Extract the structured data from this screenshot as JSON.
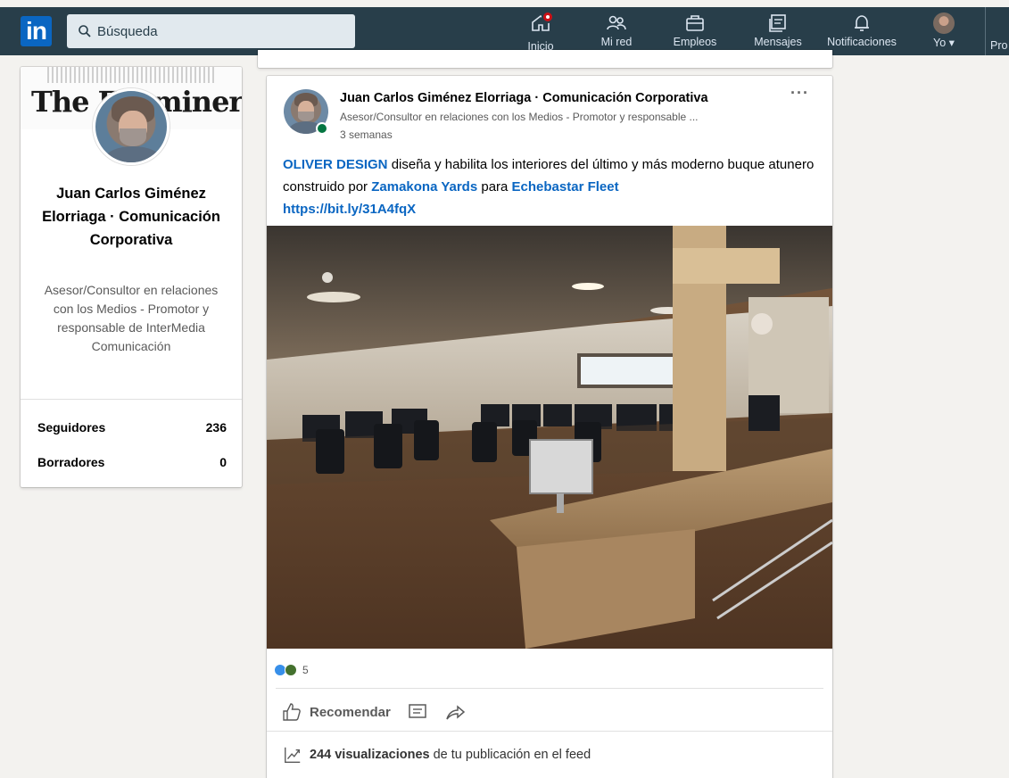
{
  "nav": {
    "logo": "in",
    "search_placeholder": "Búsqueda",
    "items": [
      {
        "label": "Inicio",
        "icon": "home-icon"
      },
      {
        "label": "Mi red",
        "icon": "my-network-icon"
      },
      {
        "label": "Empleos",
        "icon": "jobs-icon"
      },
      {
        "label": "Mensajes",
        "icon": "messaging-icon"
      },
      {
        "label": "Notificaciones",
        "icon": "notifications-icon"
      },
      {
        "label": "Yo ▾",
        "icon": "avatar"
      }
    ],
    "overflow_label": "Pro"
  },
  "profile": {
    "banner_text": "The Examiner",
    "name": "Juan Carlos Giménez Elorriaga · Comunicación Corporativa",
    "headline": "Asesor/Consultor en relaciones con los Medios - Promotor y responsable de InterMedia Comunicación",
    "stats": [
      {
        "label": "Seguidores",
        "value": "236"
      },
      {
        "label": "Borradores",
        "value": "0"
      }
    ]
  },
  "post": {
    "author": "Juan Carlos Giménez Elorriaga · Comunicación Corporativa",
    "author_headline": "Asesor/Consultor en relaciones con los Medios - Promotor y responsable ...",
    "time": "3 semanas",
    "more": "···",
    "text": {
      "mention1": "OLIVER DESIGN",
      "part1": " diseña y habilita los interiores del último y más moderno buque atunero construido por ",
      "mention2": "Zamakona Yards",
      "part2": " para ",
      "mention3": "Echebastar Fleet",
      "url": "https://bit.ly/31A4fqX"
    },
    "reactions_count": "5",
    "actions": {
      "like_label": "Recomendar"
    },
    "views": {
      "count": "244 visualizaciones",
      "suffix": "de tu publicación en el feed"
    }
  },
  "colors": {
    "nav_bg": "#283e4a",
    "brand_blue": "#0a66c2",
    "page_bg": "#f3f2ef",
    "notification_badge": "#cc1016",
    "online": "#057642"
  }
}
